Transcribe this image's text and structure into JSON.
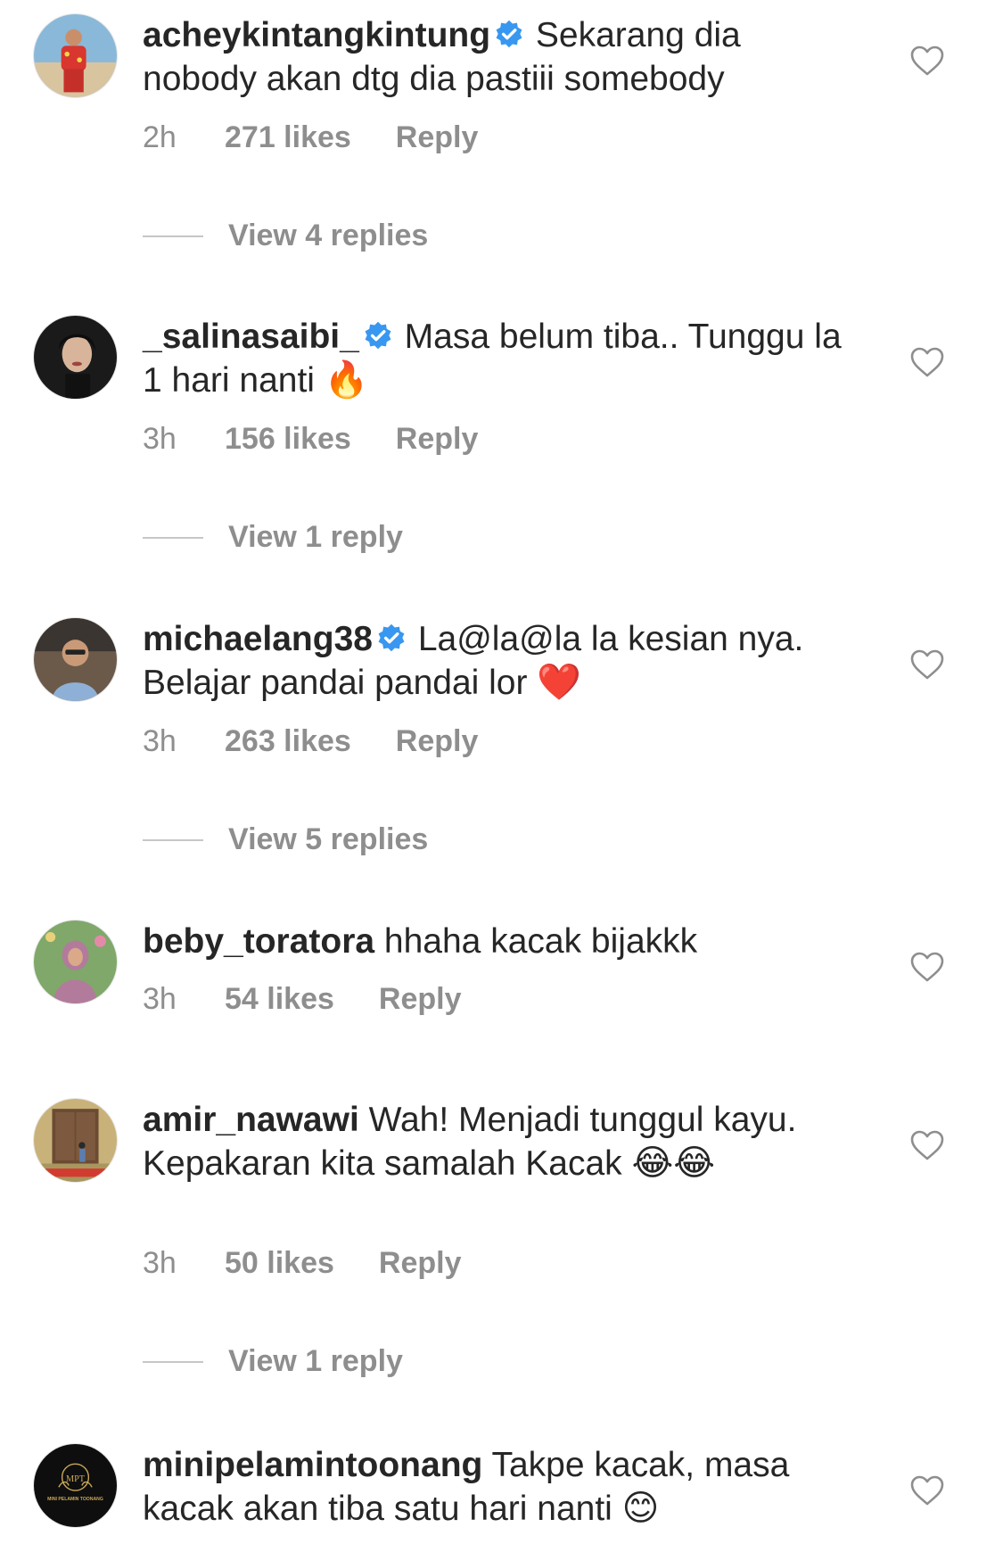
{
  "comments": [
    {
      "username": "acheykintangkintung",
      "verified": true,
      "text": "Sekarang dia nobody akan dtg dia pastiii somebody",
      "emoji": "",
      "time": "2h",
      "likes": "271 likes",
      "reply": "Reply",
      "view_replies": "View 4 replies",
      "avatar": "avatar-photo"
    },
    {
      "username": "_salinasaibi_",
      "verified": true,
      "text": "Masa belum tiba.. Tunggu la 1 hari nanti",
      "emoji": "🔥",
      "time": "3h",
      "likes": "156 likes",
      "reply": "Reply",
      "view_replies": "View 1 reply",
      "avatar": "avatar-photo"
    },
    {
      "username": "michaelang38",
      "verified": true,
      "text": "La@la@la la kesian nya. Belajar pandai pandai lor",
      "emoji": "❤️",
      "time": "3h",
      "likes": "263 likes",
      "reply": "Reply",
      "view_replies": "View 5 replies",
      "avatar": "avatar-photo"
    },
    {
      "username": "beby_toratora",
      "verified": false,
      "text": "hhaha kacak bijakkk",
      "emoji": "",
      "time": "3h",
      "likes": "54 likes",
      "reply": "Reply",
      "view_replies": "",
      "avatar": "avatar-photo"
    },
    {
      "username": "amir_nawawi",
      "verified": false,
      "text": "Wah! Menjadi tunggul kayu. Kepakaran kita samalah Kacak",
      "emoji": "😂😂",
      "time": "3h",
      "likes": "50 likes",
      "reply": "Reply",
      "view_replies": "View 1 reply",
      "avatar": "avatar-photo"
    },
    {
      "username": "minipelamintoonang",
      "verified": false,
      "text": "Takpe kacak, masa kacak akan tiba satu hari nanti",
      "emoji": "😊",
      "time": "",
      "likes": "",
      "reply": "",
      "view_replies": "",
      "avatar": "avatar-logo",
      "avatar_logo_text": "MPT",
      "avatar_logo_caption": "MINI PELAMIN TOONANG"
    }
  ],
  "colors": {
    "text": "#262626",
    "secondary": "#8e8e8e",
    "verified_badge": "#3897f0",
    "divider_line": "#c7c7c7"
  },
  "icons": {
    "like": "heart-outline-icon",
    "verified": "verified-badge-icon"
  }
}
